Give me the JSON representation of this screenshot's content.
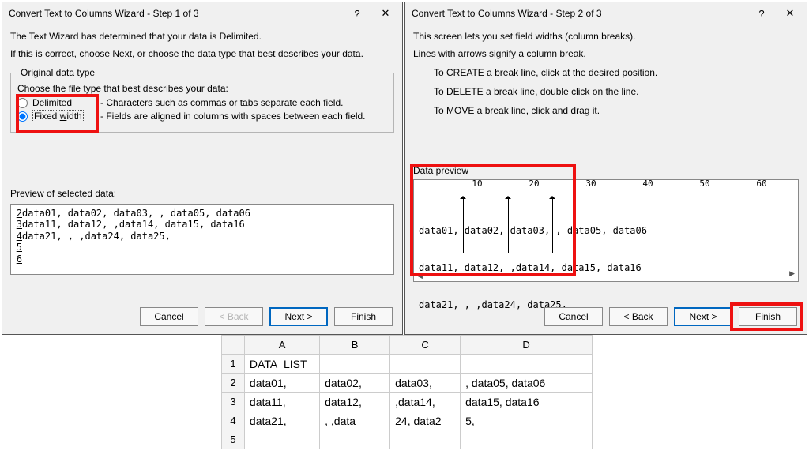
{
  "dialog1": {
    "title": "Convert Text to Columns Wizard - Step 1 of 3",
    "line1": "The Text Wizard has determined that your data is Delimited.",
    "line2": "If this is correct, choose Next, or choose the data type that best describes your data.",
    "group_legend": "Original data type",
    "choose_label": "Choose the file type that best describes your data:",
    "radio_delimited": "Delimited",
    "radio_delimited_desc": "- Characters such as commas or tabs separate each field.",
    "radio_fixed": "Fixed width",
    "radio_fixed_desc": "- Fields are aligned in columns with spaces between each field.",
    "preview_label": "Preview of selected data:",
    "preview_rows": [
      {
        "n": "2",
        "t": "data01, data02, data03, , data05, data06"
      },
      {
        "n": "3",
        "t": "data11, data12, ,data14, data15, data16"
      },
      {
        "n": "4",
        "t": "data21, , ,data24, data25,"
      },
      {
        "n": "5",
        "t": ""
      },
      {
        "n": "6",
        "t": ""
      }
    ]
  },
  "dialog2": {
    "title": "Convert Text to Columns Wizard - Step 2 of 3",
    "line1": "This screen lets you set field widths (column breaks).",
    "line2": "Lines with arrows signify a column break.",
    "instr1": "To CREATE a break line, click at the desired position.",
    "instr2": "To DELETE a break line, double click on the line.",
    "instr3": "To MOVE a break line, click and drag it.",
    "preview_label": "Data preview",
    "ruler_labels": [
      "10",
      "20",
      "30",
      "40",
      "50",
      "60"
    ],
    "data_rows": [
      "data01, data02, data03, , data05, data06",
      "data11, data12, ,data14, data15, data16",
      "data21, , ,data24, data25,"
    ]
  },
  "buttons": {
    "cancel": "Cancel",
    "back": "< Back",
    "next": "Next >",
    "finish": "Finish"
  },
  "titlebtns": {
    "help": "?",
    "close": "✕"
  },
  "sheet": {
    "cols": [
      "A",
      "B",
      "C",
      "D"
    ],
    "rows": [
      "1",
      "2",
      "3",
      "4",
      "5"
    ],
    "cells": [
      [
        "DATA_LIST",
        "",
        "",
        ""
      ],
      [
        "data01,",
        "data02,",
        "data03,",
        ", data05, data06"
      ],
      [
        "data11,",
        "data12,",
        ",data14,",
        "data15, data16"
      ],
      [
        "data21,",
        ", ,data",
        "24, data2",
        "5,"
      ],
      [
        "",
        "",
        "",
        ""
      ]
    ]
  }
}
